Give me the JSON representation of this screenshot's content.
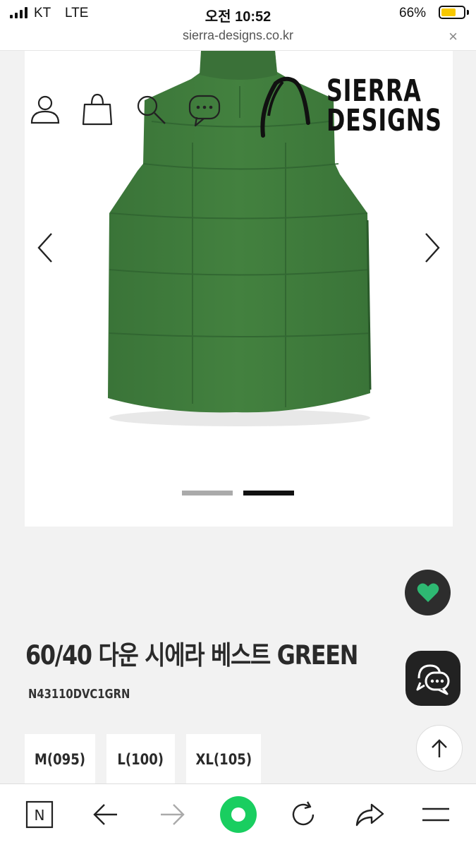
{
  "status_bar": {
    "carrier": "KT",
    "network": "LTE",
    "time": "오전 10:52",
    "battery_percent": "66%",
    "battery_level": 0.66,
    "battery_color": "#f7c800"
  },
  "url_bar": {
    "url": "sierra-designs.co.kr",
    "close_glyph": "×"
  },
  "site_header": {
    "icons": [
      "user-icon",
      "bag-icon",
      "search-icon",
      "chat-icon"
    ],
    "brand_line1": "SIERRA",
    "brand_line2": "DESIGNS"
  },
  "gallery": {
    "prev_icon": "chevron-left-icon",
    "next_icon": "chevron-right-icon",
    "slides": 2,
    "active_slide": 2,
    "product_color": "#3f7a3f"
  },
  "product": {
    "title": "60/40 다운 시에라 베스트 GREEN",
    "code": "N43110DVC1GRN",
    "sizes": [
      "M(095)",
      "L(100)",
      "XL(105)"
    ]
  },
  "floating": {
    "wishlist_icon": "heart-icon",
    "wishlist_color": "#2eb872",
    "chat_icon": "chat-bubbles-icon",
    "top_icon": "arrow-up-icon"
  },
  "toolbar": {
    "buttons": [
      "naver-home-icon",
      "back-arrow-icon",
      "forward-arrow-icon",
      "green-dot-icon",
      "reload-icon",
      "share-icon",
      "menu-icon"
    ],
    "n_label": "N",
    "accent": "#19ce60"
  }
}
